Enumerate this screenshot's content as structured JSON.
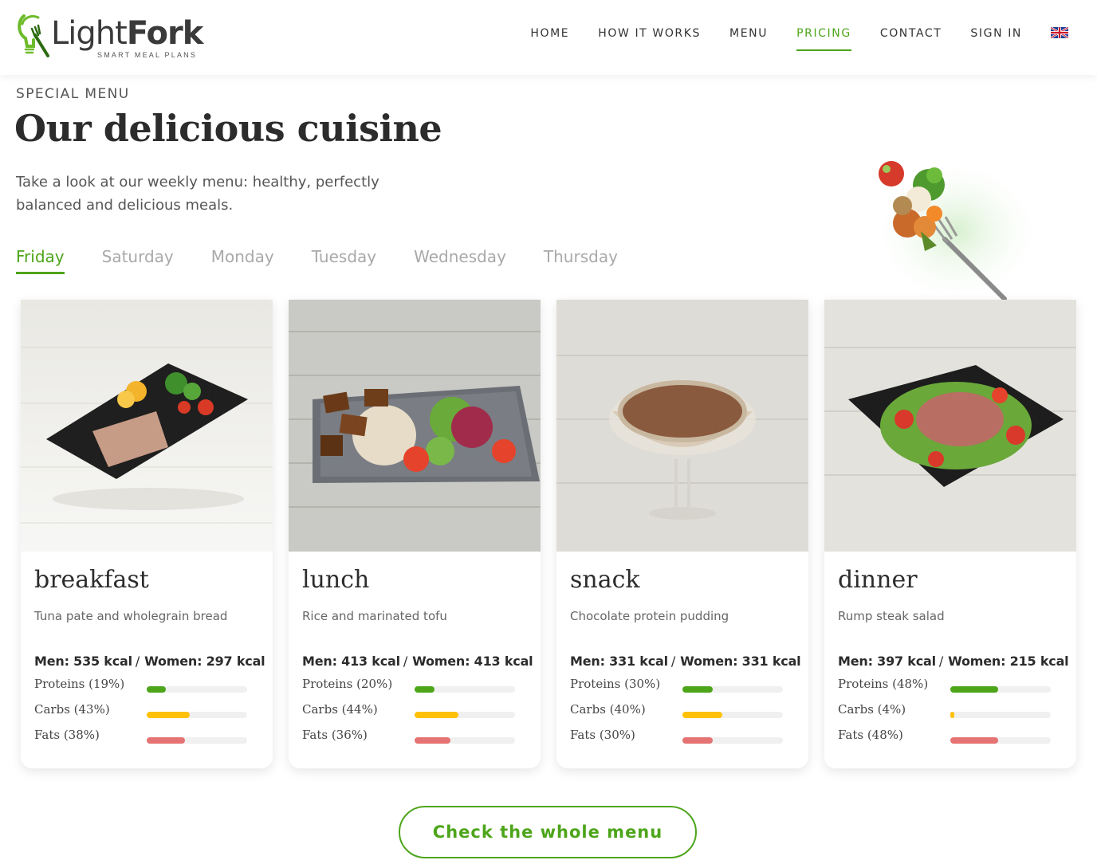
{
  "brand": {
    "name_light": "Light",
    "name_bold": "Fork",
    "tagline": "SMART MEAL PLANS"
  },
  "nav": {
    "items": [
      {
        "label": "HOME",
        "active": false
      },
      {
        "label": "HOW IT WORKS",
        "active": false
      },
      {
        "label": "MENU",
        "active": false
      },
      {
        "label": "PRICING",
        "active": true
      },
      {
        "label": "CONTACT",
        "active": false
      },
      {
        "label": "SIGN IN",
        "active": false
      }
    ],
    "language_icon": "uk-flag-icon"
  },
  "intro": {
    "eyebrow": "SPECIAL MENU",
    "title": "Our delicious cuisine",
    "lead": "Take a look at our weekly menu: healthy, perfectly balanced and delicious meals."
  },
  "tabs": [
    {
      "label": "Friday",
      "active": true
    },
    {
      "label": "Saturday",
      "active": false
    },
    {
      "label": "Monday",
      "active": false
    },
    {
      "label": "Tuesday",
      "active": false
    },
    {
      "label": "Wednesday",
      "active": false
    },
    {
      "label": "Thursday",
      "active": false
    }
  ],
  "colors": {
    "accent": "#4da51a",
    "proteins": "#4da51a",
    "carbs": "#ffc107",
    "fats": "#e57373"
  },
  "meals": [
    {
      "name": "breakfast",
      "description": "Tuna pate and wholegrain bread",
      "men": "Men: 535 kcal",
      "women": "Women: 297 kcal",
      "macros": [
        {
          "label": "Proteins (19%)",
          "percent": 19
        },
        {
          "label": "Carbs (43%)",
          "percent": 43
        },
        {
          "label": "Fats (38%)",
          "percent": 38
        }
      ]
    },
    {
      "name": "lunch",
      "description": "Rice and marinated tofu",
      "men": "Men: 413 kcal",
      "women": "Women: 413 kcal",
      "macros": [
        {
          "label": "Proteins (20%)",
          "percent": 20
        },
        {
          "label": "Carbs (44%)",
          "percent": 44
        },
        {
          "label": "Fats (36%)",
          "percent": 36
        }
      ]
    },
    {
      "name": "snack",
      "description": "Chocolate protein pudding",
      "men": "Men: 331 kcal",
      "women": "Women: 331 kcal",
      "macros": [
        {
          "label": "Proteins (30%)",
          "percent": 30
        },
        {
          "label": "Carbs (40%)",
          "percent": 40
        },
        {
          "label": "Fats (30%)",
          "percent": 30
        }
      ]
    },
    {
      "name": "dinner",
      "description": "Rump steak salad",
      "men": "Men: 397 kcal",
      "women": "Women: 215 kcal",
      "macros": [
        {
          "label": "Proteins (48%)",
          "percent": 48
        },
        {
          "label": "Carbs (4%)",
          "percent": 4
        },
        {
          "label": "Fats (48%)",
          "percent": 48
        }
      ]
    }
  ],
  "cta": {
    "label": "Check the whole menu"
  }
}
